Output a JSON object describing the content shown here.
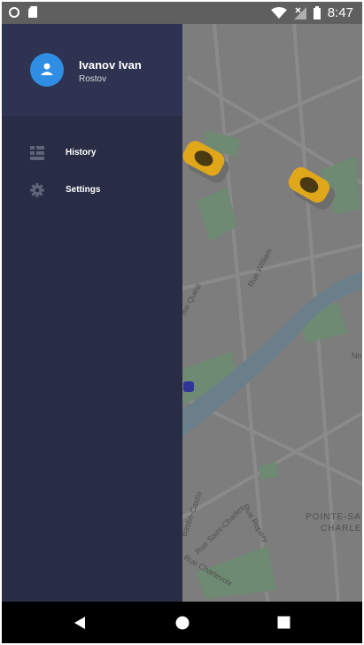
{
  "status_bar": {
    "time": "8:47",
    "icons": [
      "notification-circle-icon",
      "sd-card-icon",
      "wifi-icon",
      "signal-icon",
      "battery-icon"
    ]
  },
  "drawer": {
    "user": {
      "name": "Ivanov Ivan",
      "city": "Rostov"
    },
    "items": [
      {
        "label": "History",
        "icon": "history-list-icon"
      },
      {
        "label": "Settings",
        "icon": "gear-icon"
      }
    ]
  },
  "map": {
    "street_labels": [
      "me Quest",
      "Rue William",
      "No",
      "Bastin-Castin",
      "Rue Saint-Charles",
      "Rue Ropery",
      "Rue Charlevoix",
      "POINTE-SA",
      "CHARLE"
    ]
  },
  "nav_bar": {
    "buttons": [
      "back-icon",
      "home-icon",
      "recents-icon"
    ]
  },
  "colors": {
    "drawer_bg": "#282d45",
    "header_bg": "#2d3350",
    "avatar": "#2f8de4",
    "taxi": "#e1a71b"
  }
}
